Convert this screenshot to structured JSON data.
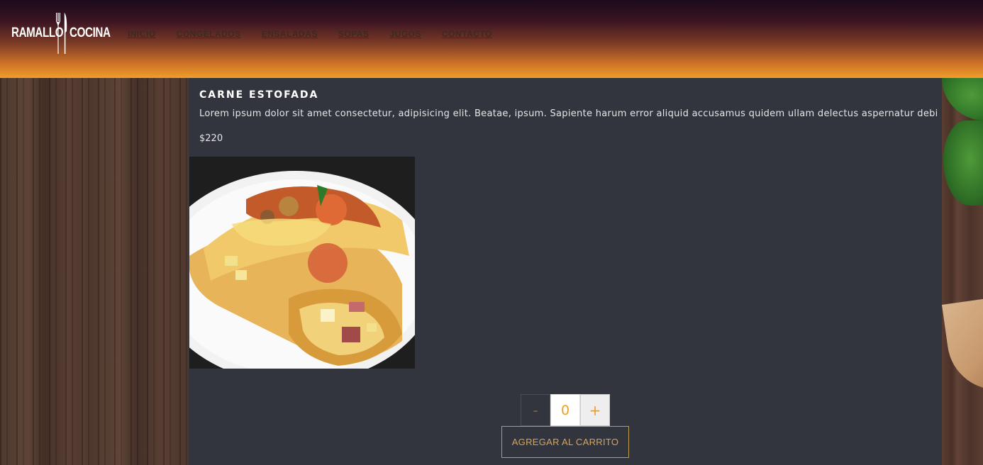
{
  "brand": {
    "left_word": "RAMALLO",
    "right_word": "COCINA",
    "icon": "fork-knife-icon"
  },
  "nav": {
    "items": [
      {
        "label": "INICIO"
      },
      {
        "label": "CONGELADOS"
      },
      {
        "label": "ENSALADAS"
      },
      {
        "label": "SOPAS"
      },
      {
        "label": "JUGOS"
      },
      {
        "label": "CONTACTO"
      }
    ]
  },
  "product": {
    "title": "CARNE ESTOFADA",
    "description": "Lorem ipsum dolor sit amet consectetur, adipisicing elit. Beatae, ipsum. Sapiente harum error aliquid accusamus quidem ullam delectus aspernatur debitis",
    "price": "$220",
    "image": "baked-crepes-photo"
  },
  "quantity": {
    "minus_label": "-",
    "value": "0",
    "plus_label": "+"
  },
  "cart": {
    "add_label": "AGREGAR AL CARRITO"
  },
  "colors": {
    "header_top": "#1b0a1c",
    "header_bottom": "#f09d2a",
    "panel": "#32353d",
    "accent": "#f09d2a",
    "button_border": "#c29a4a"
  }
}
